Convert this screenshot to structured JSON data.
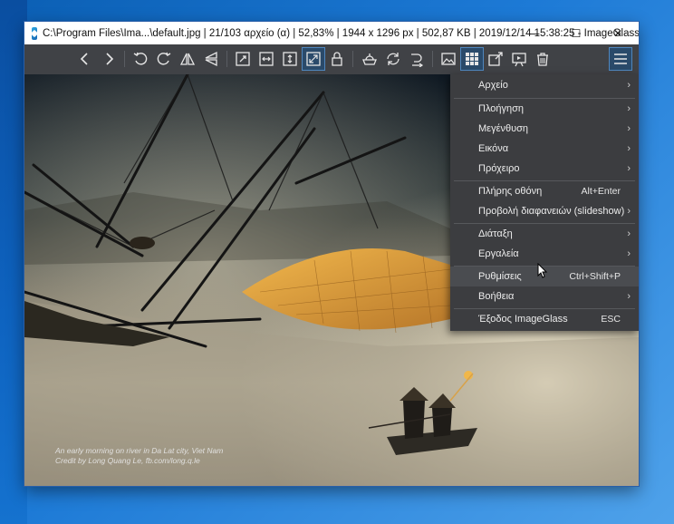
{
  "window": {
    "title": "C:\\Program Files\\Ima...\\default.jpg  |  21/103 αρχείο (α)  |  52,83%  |  1944 x 1296 px  |  502,87 KB  |  2019/12/14 15:38:25  -  ImageGlass",
    "minimize": "—",
    "maximize": "☐",
    "close": "✕"
  },
  "toolbar": {
    "buttons": [
      "prev-icon",
      "next-icon",
      "rotate-left-icon",
      "rotate-right-icon",
      "flip-horizontal-icon",
      "flip-vertical-icon",
      "auto-zoom-icon",
      "zoom-to-width-icon",
      "zoom-to-height-icon",
      "scale-to-fit-icon",
      "lock-zoom-icon",
      "pan-icon",
      "refresh-icon",
      "goto-icon",
      "gallery-icon",
      "thumbnail-icon",
      "fullscreen-icon",
      "slideshow-icon",
      "delete-icon",
      "menu-icon"
    ],
    "active": [
      "scale-to-fit-icon",
      "thumbnail-icon",
      "menu-icon"
    ]
  },
  "image": {
    "credit_line1": "An early morning on river in Da Lat city, Viet Nam",
    "credit_line2": "Credit by Long Quang Le, fb.com/long.q.le"
  },
  "menu": {
    "items": [
      {
        "label": "Αρχείο",
        "shortcut": "",
        "submenu": true
      },
      {
        "label": "Πλοήγηση",
        "shortcut": "",
        "submenu": true
      },
      {
        "label": "Μεγένθυση",
        "shortcut": "",
        "submenu": true
      },
      {
        "label": "Εικόνα",
        "shortcut": "",
        "submenu": true
      },
      {
        "label": "Πρόχειρο",
        "shortcut": "",
        "submenu": true
      },
      {
        "label": "Πλήρης οθόνη",
        "shortcut": "Alt+Enter",
        "submenu": false
      },
      {
        "label": "Προβολή διαφανειών (slideshow)",
        "shortcut": "",
        "submenu": true
      },
      {
        "label": "Διάταξη",
        "shortcut": "",
        "submenu": true
      },
      {
        "label": "Εργαλεία",
        "shortcut": "",
        "submenu": true
      },
      {
        "label": "Ρυθμίσεις",
        "shortcut": "Ctrl+Shift+P",
        "submenu": false
      },
      {
        "label": "Βοήθεια",
        "shortcut": "",
        "submenu": true
      },
      {
        "label": "Έξοδος ImageGlass",
        "shortcut": "ESC",
        "submenu": false
      }
    ],
    "arrow": "›"
  }
}
